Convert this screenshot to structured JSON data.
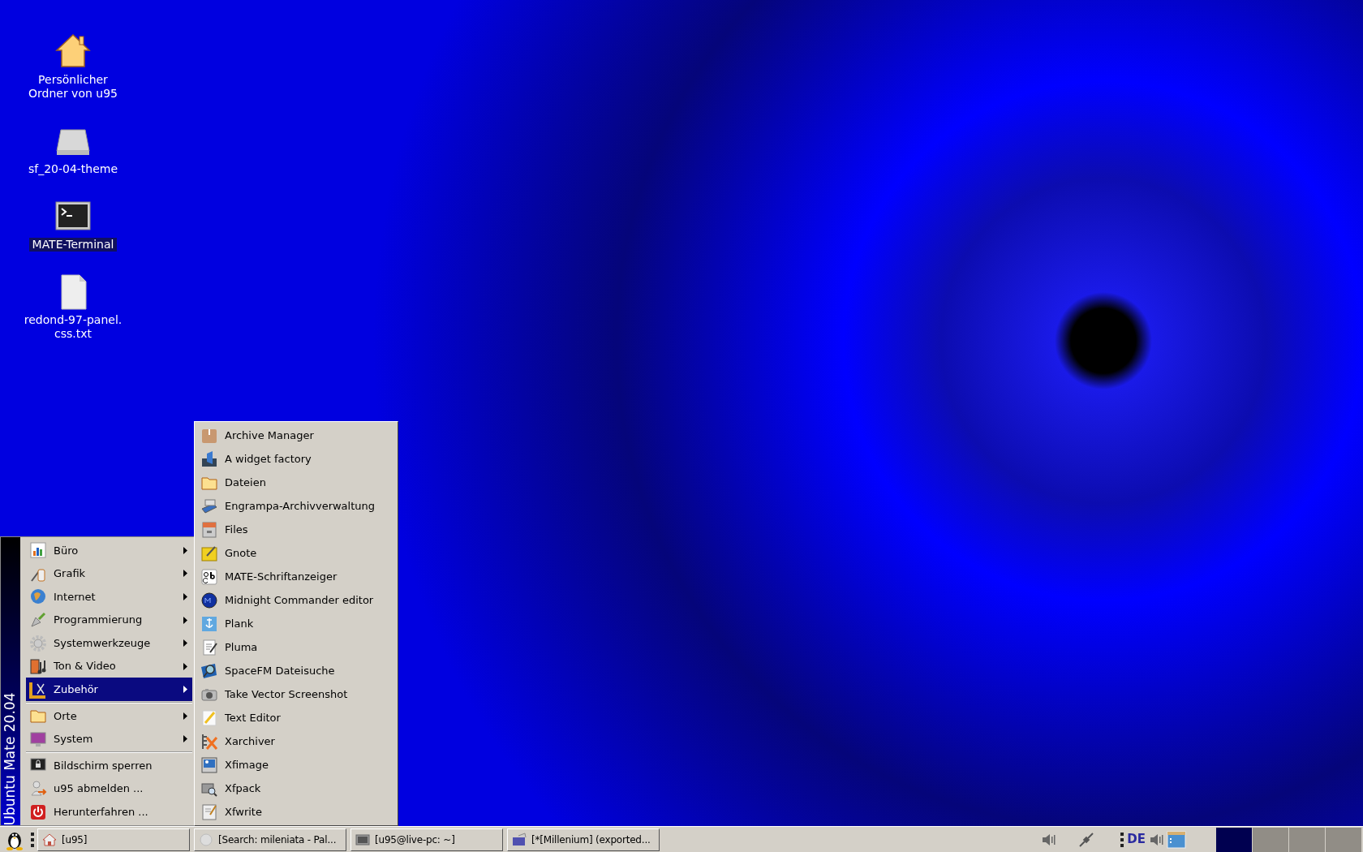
{
  "desktop_icons": [
    {
      "label": "Persönlicher Ordner von u95",
      "kind": "home",
      "selected": false
    },
    {
      "label": "sf_20-04-theme",
      "kind": "drive",
      "selected": false
    },
    {
      "label": "MATE-Terminal",
      "kind": "terminal",
      "selected": true
    },
    {
      "label": "redond-97-panel.\ncss.txt",
      "kind": "file",
      "selected": false
    }
  ],
  "start_menu": {
    "sidebar_title": "Ubuntu Mate 20.04",
    "sections": [
      [
        {
          "label": "Büro",
          "has_submenu": true,
          "selected": false
        },
        {
          "label": "Grafik",
          "has_submenu": true,
          "selected": false
        },
        {
          "label": "Internet",
          "has_submenu": true,
          "selected": false
        },
        {
          "label": "Programmierung",
          "has_submenu": true,
          "selected": false
        },
        {
          "label": "Systemwerkzeuge",
          "has_submenu": true,
          "selected": false
        },
        {
          "label": "Ton & Video",
          "has_submenu": true,
          "selected": false
        },
        {
          "label": "Zubehör",
          "has_submenu": true,
          "selected": true
        }
      ],
      [
        {
          "label": "Orte",
          "has_submenu": true,
          "selected": false
        },
        {
          "label": "System",
          "has_submenu": true,
          "selected": false
        }
      ],
      [
        {
          "label": "Bildschirm sperren",
          "has_submenu": false,
          "selected": false
        },
        {
          "label": "u95 abmelden ...",
          "has_submenu": false,
          "selected": false
        },
        {
          "label": "Herunterfahren ...",
          "has_submenu": false,
          "selected": false
        }
      ]
    ]
  },
  "submenu": {
    "items": [
      "Archive Manager",
      "A widget factory",
      "Dateien",
      "Engrampa-Archivverwaltung",
      "Files",
      "Gnote",
      "MATE-Schriftanzeiger",
      "Midnight Commander editor",
      "Plank",
      "Pluma",
      "SpaceFM Dateisuche",
      "Take Vector Screenshot",
      "Text Editor",
      "Xarchiver",
      "Xfimage",
      "Xfpack",
      "Xfwrite"
    ]
  },
  "taskbar": {
    "tasks": [
      {
        "label": "[u95]"
      },
      {
        "label": "[Search: mileniata - Pal..."
      },
      {
        "label": "[u95@live-pc: ~]"
      },
      {
        "label": "[*[Millenium] (exported..."
      }
    ],
    "keyboard_layout": "DE",
    "workspaces": [
      {
        "selected": true
      },
      {
        "selected": false
      },
      {
        "selected": false
      },
      {
        "selected": false
      }
    ]
  }
}
